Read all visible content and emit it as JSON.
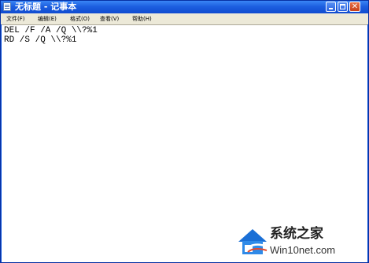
{
  "window": {
    "title": "无标题 - 记事本"
  },
  "menu": {
    "items": [
      {
        "label": "文件(F)"
      },
      {
        "label": "编辑(E)"
      },
      {
        "label": "格式(O)"
      },
      {
        "label": "查看(V)"
      },
      {
        "label": "帮助(H)"
      }
    ]
  },
  "editor": {
    "lines": [
      "DEL /F /A /Q \\\\?%1",
      "RD /S /Q \\\\?%1"
    ]
  },
  "watermark": {
    "title": "系统之家",
    "url": "Win10net.com"
  },
  "colors": {
    "titlebar": "#1d5fe0",
    "menubar": "#ece9d8",
    "close_button": "#c9401a"
  },
  "icons": [
    "notepad-icon",
    "minimize-icon",
    "maximize-icon",
    "close-icon",
    "house-logo-icon"
  ]
}
